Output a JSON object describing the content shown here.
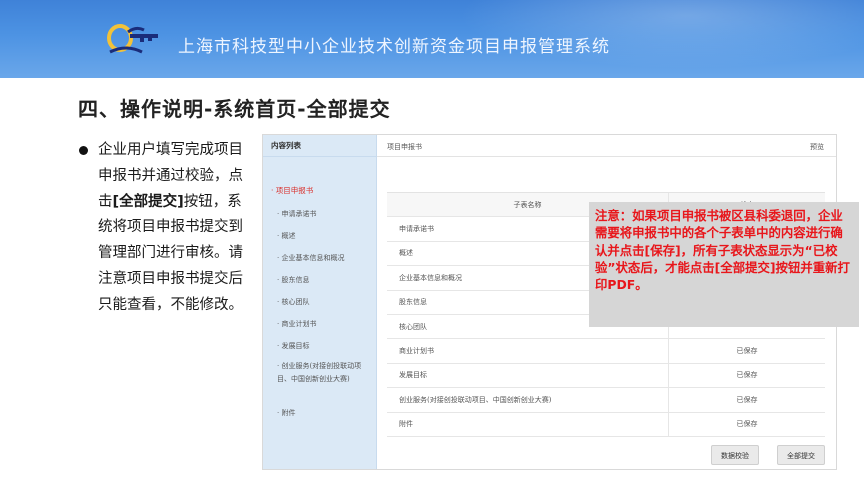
{
  "colors": {
    "banner_blue": "#4d93e3",
    "notice_red": "#e8161b",
    "sidebar_blue": "#dbe9f6",
    "active_red": "#d9302c"
  },
  "header": {
    "logo_icon": "key-logo-icon",
    "title": "上海市科技型中小企业技术创新资金项目申报管理系统"
  },
  "slide": {
    "title": "四、操作说明-系统首页-全部提交"
  },
  "bullet": {
    "text_before": "企业用户填写完成项目申报书并通过校验，点击",
    "bold": "[全部提交]",
    "text_after": "按钮，系统将项目申报书提交到管理部门进行审核。请注意项目申报书提交后只能查看，不能修改。"
  },
  "screenshot": {
    "sidebar_title": "内容列表",
    "group_label": "· 项目申报书",
    "items": [
      "· 申请承诺书",
      "· 概述",
      "· 企业基本信息和概况",
      "· 股东信息",
      "· 核心团队",
      "· 商业计划书",
      "· 发展目标",
      "· 创业服务(对接创投联动项目、中国创新创业大赛)",
      "· 附件"
    ],
    "main_title": "项目申报书",
    "preview_label": "预览",
    "columns": [
      "子表名称",
      "状态"
    ],
    "rows": [
      {
        "name": "申请承诺书",
        "status": ""
      },
      {
        "name": "概述",
        "status": ""
      },
      {
        "name": "企业基本信息和概况",
        "status": ""
      },
      {
        "name": "股东信息",
        "status": ""
      },
      {
        "name": "核心团队",
        "status": ""
      },
      {
        "name": "商业计划书",
        "status": "已保存"
      },
      {
        "name": "发展目标",
        "status": "已保存"
      },
      {
        "name": "创业服务(对接创投联动项目、中国创新创业大赛)",
        "status": "已保存"
      },
      {
        "name": "附件",
        "status": "已保存"
      }
    ],
    "btn_validate": "数据校验",
    "btn_submit": "全部提交"
  },
  "notice": {
    "text": "注意：如果项目申报书被区县科委退回，企业需要将申报书中的各个子表单中的内容进行确认并点击[保存]，所有子表状态显示为“已校验”状态后，才能点击[全部提交]按钮并重新打印PDF。"
  }
}
